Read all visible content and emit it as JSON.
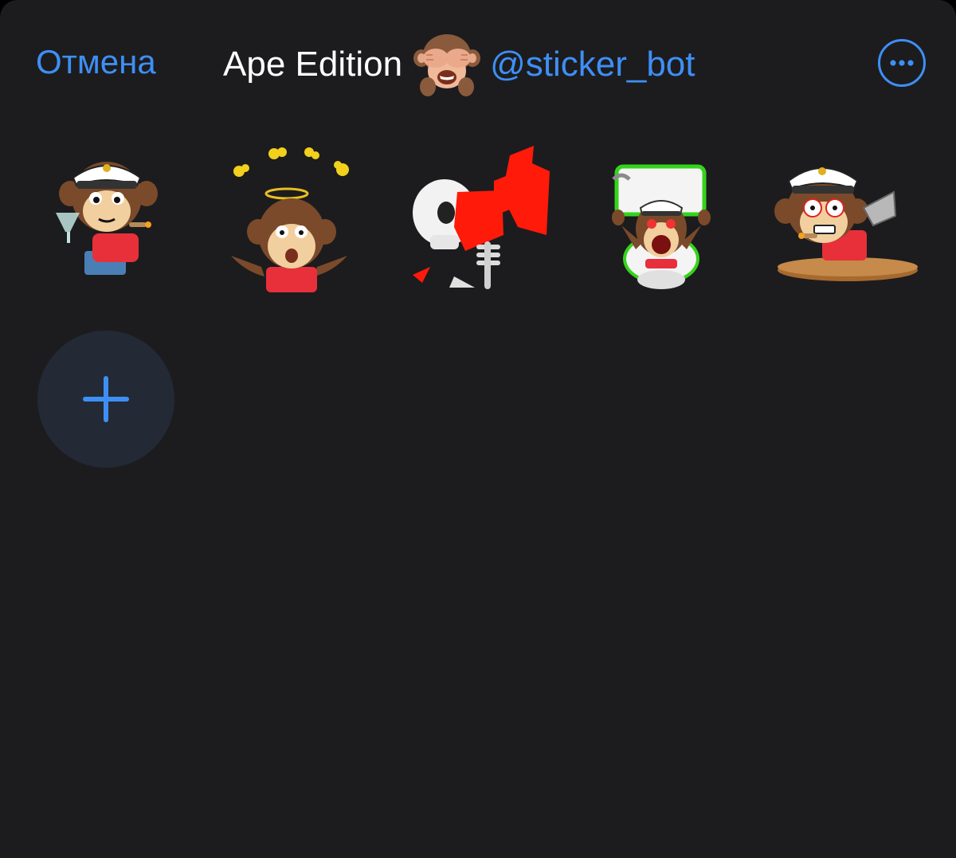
{
  "header": {
    "cancel_label": "Отмена",
    "title": "Ape Edition",
    "title_emoji": "see-no-evil-monkey-emoji",
    "bot_handle": "@sticker_bot",
    "more_icon": "ellipsis-circle-icon"
  },
  "stickers": [
    {
      "name": "captain-monkey-cocktail-sticker"
    },
    {
      "name": "dizzy-monkey-halo-sticker"
    },
    {
      "name": "skeleton-blood-sticker"
    },
    {
      "name": "angry-monkey-toilet-sticker"
    },
    {
      "name": "captain-monkey-laptop-sticker"
    }
  ],
  "add_button": {
    "icon": "plus-icon"
  },
  "colors": {
    "background": "#1c1c1e",
    "accent": "#3e8ff5",
    "add_button_bg": "#232a36",
    "title_text": "#ffffff"
  }
}
